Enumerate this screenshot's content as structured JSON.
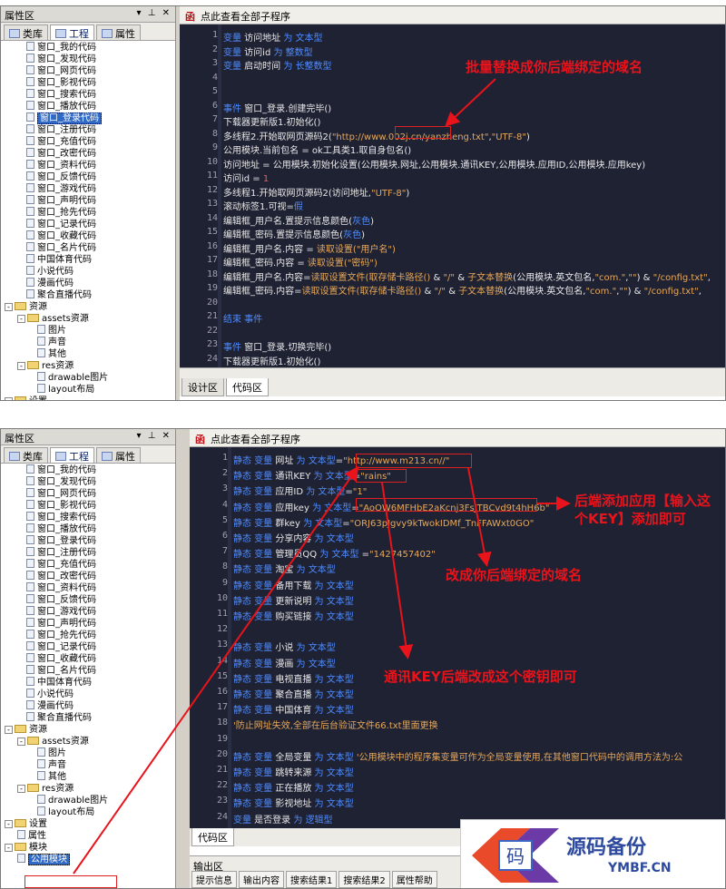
{
  "panel": {
    "title": "属性区",
    "controls": "▾ ⊥ ✕",
    "tabs": [
      "类库",
      "工程",
      "属性"
    ]
  },
  "screen1": {
    "tree": [
      {
        "label": "窗口_我的代码",
        "indent": 28,
        "kind": "file"
      },
      {
        "label": "窗口_发现代码",
        "indent": 28,
        "kind": "file"
      },
      {
        "label": "窗口_网页代码",
        "indent": 28,
        "kind": "file"
      },
      {
        "label": "窗口_影视代码",
        "indent": 28,
        "kind": "file"
      },
      {
        "label": "窗口_搜索代码",
        "indent": 28,
        "kind": "file"
      },
      {
        "label": "窗口_播放代码",
        "indent": 28,
        "kind": "file"
      },
      {
        "label": "窗口_登录代码",
        "indent": 28,
        "kind": "file",
        "selected": true
      },
      {
        "label": "窗口_注册代码",
        "indent": 28,
        "kind": "file"
      },
      {
        "label": "窗口_充值代码",
        "indent": 28,
        "kind": "file"
      },
      {
        "label": "窗口_改密代码",
        "indent": 28,
        "kind": "file"
      },
      {
        "label": "窗口_资料代码",
        "indent": 28,
        "kind": "file"
      },
      {
        "label": "窗口_反馈代码",
        "indent": 28,
        "kind": "file"
      },
      {
        "label": "窗口_游戏代码",
        "indent": 28,
        "kind": "file"
      },
      {
        "label": "窗口_声明代码",
        "indent": 28,
        "kind": "file"
      },
      {
        "label": "窗口_抢先代码",
        "indent": 28,
        "kind": "file"
      },
      {
        "label": "窗口_记录代码",
        "indent": 28,
        "kind": "file"
      },
      {
        "label": "窗口_收藏代码",
        "indent": 28,
        "kind": "file"
      },
      {
        "label": "窗口_名片代码",
        "indent": 28,
        "kind": "file"
      },
      {
        "label": "中国体育代码",
        "indent": 28,
        "kind": "file"
      },
      {
        "label": "小说代码",
        "indent": 28,
        "kind": "file"
      },
      {
        "label": "漫画代码",
        "indent": 28,
        "kind": "file"
      },
      {
        "label": "聚合直播代码",
        "indent": 28,
        "kind": "file"
      },
      {
        "label": "资源",
        "indent": 4,
        "kind": "folder",
        "expander": "-"
      },
      {
        "label": "assets资源",
        "indent": 18,
        "kind": "folder",
        "expander": "-"
      },
      {
        "label": "图片",
        "indent": 40,
        "kind": "file"
      },
      {
        "label": "声音",
        "indent": 40,
        "kind": "file"
      },
      {
        "label": "其他",
        "indent": 40,
        "kind": "file"
      },
      {
        "label": "res资源",
        "indent": 18,
        "kind": "folder",
        "expander": "-"
      },
      {
        "label": "drawable图片",
        "indent": 40,
        "kind": "file"
      },
      {
        "label": "layout布局",
        "indent": 40,
        "kind": "file"
      },
      {
        "label": "设置",
        "indent": 4,
        "kind": "folder",
        "expander": "-"
      }
    ],
    "editor_title": "点此查看全部子程序",
    "editor_icon": "函",
    "code": [
      {
        "n": "1",
        "t": "            <k>变量</k> 访问地址 <k>为</k> <k>文本型</k>"
      },
      {
        "n": "2",
        "t": "  <k>变量</k> 访问id <k>为</k> <k>整数型</k>"
      },
      {
        "n": "3",
        "t": "  <k>变量</k> 启动时间 <k>为</k> <k>长整数型</k>"
      },
      {
        "n": "4",
        "t": ""
      },
      {
        "n": "5",
        "t": ""
      },
      {
        "n": "6",
        "t": "<k>事件</k> 窗口_登录.创建完毕()"
      },
      {
        "n": "7",
        "t": "  下载器更新版1.初始化()"
      },
      {
        "n": "8",
        "t": "     多线程2.开始取网页源码2(<s>\"http://www.002j.cn/yanzheng.txt\"</s>,<s>\"UTF-8\"</s>)"
      },
      {
        "n": "9",
        "t": "  公用模块.当前包名 = ok工具类1.取自身包名()"
      },
      {
        "n": "10",
        "t": "  访问地址 = 公用模块.初始化设置(公用模块.网址,公用模块.通讯KEY,公用模块.应用ID,公用模块.应用key)"
      },
      {
        "n": "11",
        "t": "  访问id = <n>1</n>"
      },
      {
        "n": "12",
        "t": "  多线程1.开始取网页源码2(访问地址,<s>\"UTF-8\"</s>)"
      },
      {
        "n": "13",
        "t": "  滚动标签1.可视=<k>假</k>"
      },
      {
        "n": "14",
        "t": "  编辑框_用户名.置提示信息颜色(<k>灰色</k>)"
      },
      {
        "n": "15",
        "t": "  编辑框_密码.置提示信息颜色(<k>灰色</k>)"
      },
      {
        "n": "16",
        "t": "  编辑框_用户名.内容 = <s>读取设置(\"用户名\")</s>"
      },
      {
        "n": "17",
        "t": "  编辑框_密码.内容 = <s>读取设置(\"密码\")</s>"
      },
      {
        "n": "18",
        "t": "  编辑框_用户名.内容=<s>读取设置文件(取存储卡路径()</s> & <s>\"/\"</s> & <s>子文本替换</s>(公用模块.英文包名,<s>\"com.\"</s>,<s>\"\"</s>) & <s>\"/config.txt\"</s>,"
      },
      {
        "n": "19",
        "t": "  编辑框_密码.内容=<s>读取设置文件(取存储卡路径()</s> & <s>\"/\"</s> & <s>子文本替换</s>(公用模块.英文包名,<s>\"com.\"</s>,<s>\"\"</s>) & <s>\"/config.txt\"</s>,"
      },
      {
        "n": "20",
        "t": ""
      },
      {
        "n": "21",
        "t": "<k>结束 事件</k>"
      },
      {
        "n": "22",
        "t": ""
      },
      {
        "n": "23",
        "t": "<k>事件</k> 窗口_登录.切换完毕()"
      },
      {
        "n": "24",
        "t": "  下载器更新版1.初始化()"
      }
    ],
    "bottom_tabs": [
      "设计区",
      "代码区"
    ],
    "annotation": "批量替换成你后端绑定的域名"
  },
  "screen2": {
    "tree": [
      {
        "label": "窗口_我的代码",
        "indent": 28,
        "kind": "file"
      },
      {
        "label": "窗口_发现代码",
        "indent": 28,
        "kind": "file"
      },
      {
        "label": "窗口_网页代码",
        "indent": 28,
        "kind": "file"
      },
      {
        "label": "窗口_影视代码",
        "indent": 28,
        "kind": "file"
      },
      {
        "label": "窗口_搜索代码",
        "indent": 28,
        "kind": "file"
      },
      {
        "label": "窗口_播放代码",
        "indent": 28,
        "kind": "file"
      },
      {
        "label": "窗口_登录代码",
        "indent": 28,
        "kind": "file"
      },
      {
        "label": "窗口_注册代码",
        "indent": 28,
        "kind": "file"
      },
      {
        "label": "窗口_充值代码",
        "indent": 28,
        "kind": "file"
      },
      {
        "label": "窗口_改密代码",
        "indent": 28,
        "kind": "file"
      },
      {
        "label": "窗口_资料代码",
        "indent": 28,
        "kind": "file"
      },
      {
        "label": "窗口_反馈代码",
        "indent": 28,
        "kind": "file"
      },
      {
        "label": "窗口_游戏代码",
        "indent": 28,
        "kind": "file"
      },
      {
        "label": "窗口_声明代码",
        "indent": 28,
        "kind": "file"
      },
      {
        "label": "窗口_抢先代码",
        "indent": 28,
        "kind": "file"
      },
      {
        "label": "窗口_记录代码",
        "indent": 28,
        "kind": "file"
      },
      {
        "label": "窗口_收藏代码",
        "indent": 28,
        "kind": "file"
      },
      {
        "label": "窗口_名片代码",
        "indent": 28,
        "kind": "file"
      },
      {
        "label": "中国体育代码",
        "indent": 28,
        "kind": "file"
      },
      {
        "label": "小说代码",
        "indent": 28,
        "kind": "file"
      },
      {
        "label": "漫画代码",
        "indent": 28,
        "kind": "file"
      },
      {
        "label": "聚合直播代码",
        "indent": 28,
        "kind": "file"
      },
      {
        "label": "资源",
        "indent": 4,
        "kind": "folder",
        "expander": "-"
      },
      {
        "label": "assets资源",
        "indent": 18,
        "kind": "folder",
        "expander": "-"
      },
      {
        "label": "图片",
        "indent": 40,
        "kind": "file"
      },
      {
        "label": "声音",
        "indent": 40,
        "kind": "file"
      },
      {
        "label": "其他",
        "indent": 40,
        "kind": "file"
      },
      {
        "label": "res资源",
        "indent": 18,
        "kind": "folder",
        "expander": "-"
      },
      {
        "label": "drawable图片",
        "indent": 40,
        "kind": "file"
      },
      {
        "label": "layout布局",
        "indent": 40,
        "kind": "file"
      },
      {
        "label": "设置",
        "indent": 4,
        "kind": "folder",
        "expander": "-"
      },
      {
        "label": "属性",
        "indent": 18,
        "kind": "file"
      },
      {
        "label": "模块",
        "indent": 4,
        "kind": "folder",
        "expander": "-"
      },
      {
        "label": "公用模块",
        "indent": 18,
        "kind": "file",
        "selected": true
      }
    ],
    "editor_title": "点此查看全部子程序",
    "editor_icon": "函",
    "code": [
      {
        "n": "1",
        "t": "<k>静态 变量</k> 网址 <k>为</k> <k>文本型</k>=<s>\"http://www.m213.cn//\"</s>"
      },
      {
        "n": "2",
        "t": "<k>静态 变量</k> 通讯KEY <k>为</k> <k>文本型</k>=<s>\"rains\"</s>"
      },
      {
        "n": "3",
        "t": "<k>静态 变量</k> 应用ID <k>为</k> <k>文本型</k>=<s>\"1\"</s>"
      },
      {
        "n": "4",
        "t": "<k>静态 变量</k> 应用key <k>为</k> <k>文本型</k>=<s>\"AoOW6MFHbE2aKcnj3FsJTBCvd9t4hH6b\"</s>"
      },
      {
        "n": "5",
        "t": "<k>静态 变量</k> 群key <k>为</k> <k>文本型</k>=<s>\"ORJ63pJgvy9kTwokIDMf_TnFFAWxt0GO\"</s>"
      },
      {
        "n": "6",
        "t": "<k>静态 变量</k> 分享内容 <k>为</k> <k>文本型</k>"
      },
      {
        "n": "7",
        "t": "<k>静态 变量</k> 管理员QQ <k>为</k> <k>文本型</k>          =<s>\"1427457402\"</s>"
      },
      {
        "n": "8",
        "t": "<k>静态 变量</k> 淘宝 <k>为</k> <k>文本型</k>"
      },
      {
        "n": "9",
        "t": "<k>静态 变量</k> 备用下载 <k>为</k> <k>文本型</k>"
      },
      {
        "n": "10",
        "t": "<k>静态 变量</k> 更新说明 <k>为</k> <k>文本型</k>"
      },
      {
        "n": "11",
        "t": "<k>静态 变量</k> 购买链接 <k>为</k> <k>文本型</k>"
      },
      {
        "n": "12",
        "t": ""
      },
      {
        "n": "13",
        "t": "<k>静态 变量</k> 小说 <k>为</k> <k>文本型</k>"
      },
      {
        "n": "14",
        "t": "<k>静态 变量</k> 漫画 <k>为</k> <k>文本型</k>"
      },
      {
        "n": "15",
        "t": "<k>静态 变量</k> 电视直播 <k>为</k> <k>文本型</k>"
      },
      {
        "n": "16",
        "t": "<k>静态 变量</k> 聚合直播 <k>为</k> <k>文本型</k>"
      },
      {
        "n": "17",
        "t": "<k>静态 变量</k> 中国体育 <k>为</k> <k>文本型</k>"
      },
      {
        "n": "18",
        "t": "<s>'防止网址失效,全部在后台验证文件66.txt里面更换</s>"
      },
      {
        "n": "19",
        "t": ""
      },
      {
        "n": "20",
        "t": "<k>静态 变量</k> 全局变量 <k>为</k> <k>文本型</k>  <s>'公用模块中的程序集变量可作为全局变量使用,在其他窗口代码中的调用方法为:公</s>"
      },
      {
        "n": "21",
        "t": "<k>静态 变量</k> 跳转来源 <k>为</k> <k>文本型</k>"
      },
      {
        "n": "22",
        "t": "<k>静态 变量</k> 正在播放 <k>为</k> <k>文本型</k>"
      },
      {
        "n": "23",
        "t": "<k>静态 变量</k> 影视地址 <k>为</k> <k>文本型</k>"
      },
      {
        "n": "24",
        "t": "<k>变量</k> 是否登录 <k>为</k> <k>逻辑型</k>"
      }
    ],
    "bottom_tabs": [
      "代码区"
    ],
    "output": {
      "title": "输出区",
      "tabs": [
        "提示信息",
        "输出内容",
        "搜索结果1",
        "搜索结果2",
        "属性帮助"
      ]
    },
    "annotations": {
      "a1": "后端添加应用【输入这",
      "a2": "个KEY】添加即可",
      "a3": "改成你后端绑定的域名",
      "a4": "通讯KEY后端改成这个密钥即可"
    }
  },
  "watermark": {
    "glyph": "码",
    "title": "源码备份",
    "site": "YMBF.CN"
  },
  "colors": {
    "annotation": "#e8131b",
    "code_bg": "#1f2233",
    "keyword": "#4f8cff",
    "string": "#e6a85a"
  }
}
